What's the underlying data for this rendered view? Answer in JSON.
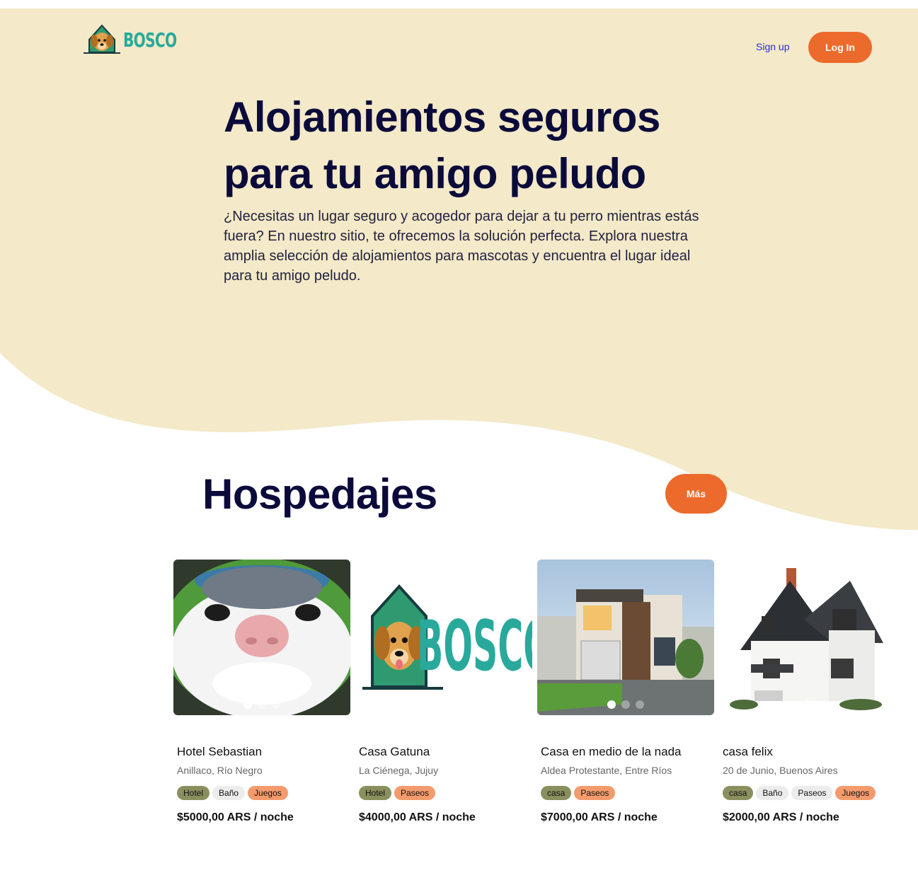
{
  "header": {
    "logo_text": "BOSCO",
    "signup_label": "Sign up",
    "login_label": "Log In"
  },
  "hero": {
    "title_line1": "Alojamientos seguros",
    "title_line2": "para tu amigo peludo",
    "description": "¿Necesitas un lugar seguro y acogedor para dejar a tu perro mientras estás fuera? En nuestro sitio, te ofrecemos la solución perfecta. Explora nuestra amplia selección de alojamientos para mascotas y encuentra el lugar ideal para tu amigo peludo."
  },
  "section": {
    "title": "Hospedajes",
    "more_label": "Más"
  },
  "colors": {
    "hero_bg": "#f4e9c8",
    "accent": "#ec6a2c",
    "title": "#0b0b3b",
    "brand_teal": "#29a99b"
  },
  "cards": [
    {
      "name": "Hotel Sebastian",
      "location": "Anillaco, Río Negro",
      "image": "cat-closeup-photo",
      "tags": [
        "Hotel",
        "Baño",
        "Juegos"
      ],
      "price": "$5000,00 ARS / noche"
    },
    {
      "name": "Casa Gatuna",
      "location": "La Ciénega, Jujuy",
      "image": "bosco-logo-image",
      "tags": [
        "Hotel",
        "Paseos"
      ],
      "price": "$4000,00 ARS / noche"
    },
    {
      "name": "Casa en medio de la nada",
      "location": "Aldea Protestante, Entre Ríos",
      "image": "modern-house-photo",
      "tags": [
        "casa",
        "Paseos"
      ],
      "price": "$7000,00 ARS / noche"
    },
    {
      "name": "casa felix",
      "location": "20 de Junio, Buenos Aires",
      "image": "classic-house-photo",
      "tags": [
        "casa",
        "Baño",
        "Paseos",
        "Juegos"
      ],
      "price": "$2000,00 ARS / noche"
    }
  ]
}
